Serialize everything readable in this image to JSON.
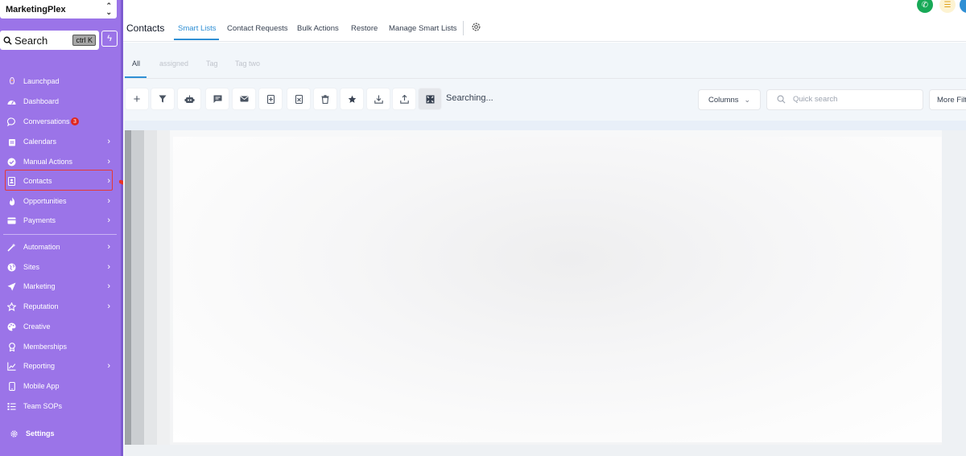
{
  "sidebar": {
    "account_name": "MarketingPlex",
    "search_label": "Search",
    "search_shortcut": "ctrl K",
    "items": [
      {
        "label": "Launchpad",
        "icon": "rocket-icon"
      },
      {
        "label": "Dashboard",
        "icon": "dashboard-icon"
      },
      {
        "label": "Conversations",
        "icon": "chat-icon",
        "badge": "3"
      },
      {
        "label": "Calendars",
        "icon": "calendar-icon"
      },
      {
        "label": "Manual Actions",
        "icon": "check-circle-icon"
      },
      {
        "label": "Contacts",
        "icon": "contact-book-icon"
      },
      {
        "label": "Opportunities",
        "icon": "flame-icon"
      },
      {
        "label": "Payments",
        "icon": "card-icon"
      },
      {
        "label": "Automation",
        "icon": "magic-wand-icon"
      },
      {
        "label": "Sites",
        "icon": "globe-icon"
      },
      {
        "label": "Marketing",
        "icon": "send-icon"
      },
      {
        "label": "Reputation",
        "icon": "star-icon"
      },
      {
        "label": "Creative",
        "icon": "palette-icon"
      },
      {
        "label": "Memberships",
        "icon": "award-icon"
      },
      {
        "label": "Reporting",
        "icon": "chart-icon"
      },
      {
        "label": "Mobile App",
        "icon": "mobile-icon"
      },
      {
        "label": "Team SOPs",
        "icon": "list-icon"
      },
      {
        "label": "Settings",
        "icon": "gear-icon"
      }
    ],
    "highlighted_item": "Contacts",
    "accent_color": "#9b74e8"
  },
  "header": {
    "title": "Contacts",
    "tabs": [
      {
        "label": "Smart Lists",
        "active": true
      },
      {
        "label": "Contact Requests"
      },
      {
        "label": "Bulk Actions"
      },
      {
        "label": "Restore"
      },
      {
        "label": "Manage Smart Lists"
      }
    ]
  },
  "subtabs": [
    {
      "label": "All",
      "active": true
    },
    {
      "label": "assigned"
    },
    {
      "label": "Tag"
    },
    {
      "label": "Tag two"
    }
  ],
  "toolbar": {
    "buttons": [
      "add-icon",
      "filter-icon",
      "automation-icon",
      "message-icon",
      "email-icon",
      "add-tag-icon",
      "remove-tag-icon",
      "delete-icon",
      "star-icon",
      "import-icon",
      "export-icon",
      "merge-icon"
    ],
    "status_text": "Searching...",
    "columns_label": "Columns",
    "quick_search_placeholder": "Quick search",
    "more_filters_label": "More Filters"
  },
  "colors": {
    "active_tab": "#2f8fd4",
    "phone_button": "#18a957",
    "badge": "#e0271f",
    "highlight_box": "#e53935"
  }
}
